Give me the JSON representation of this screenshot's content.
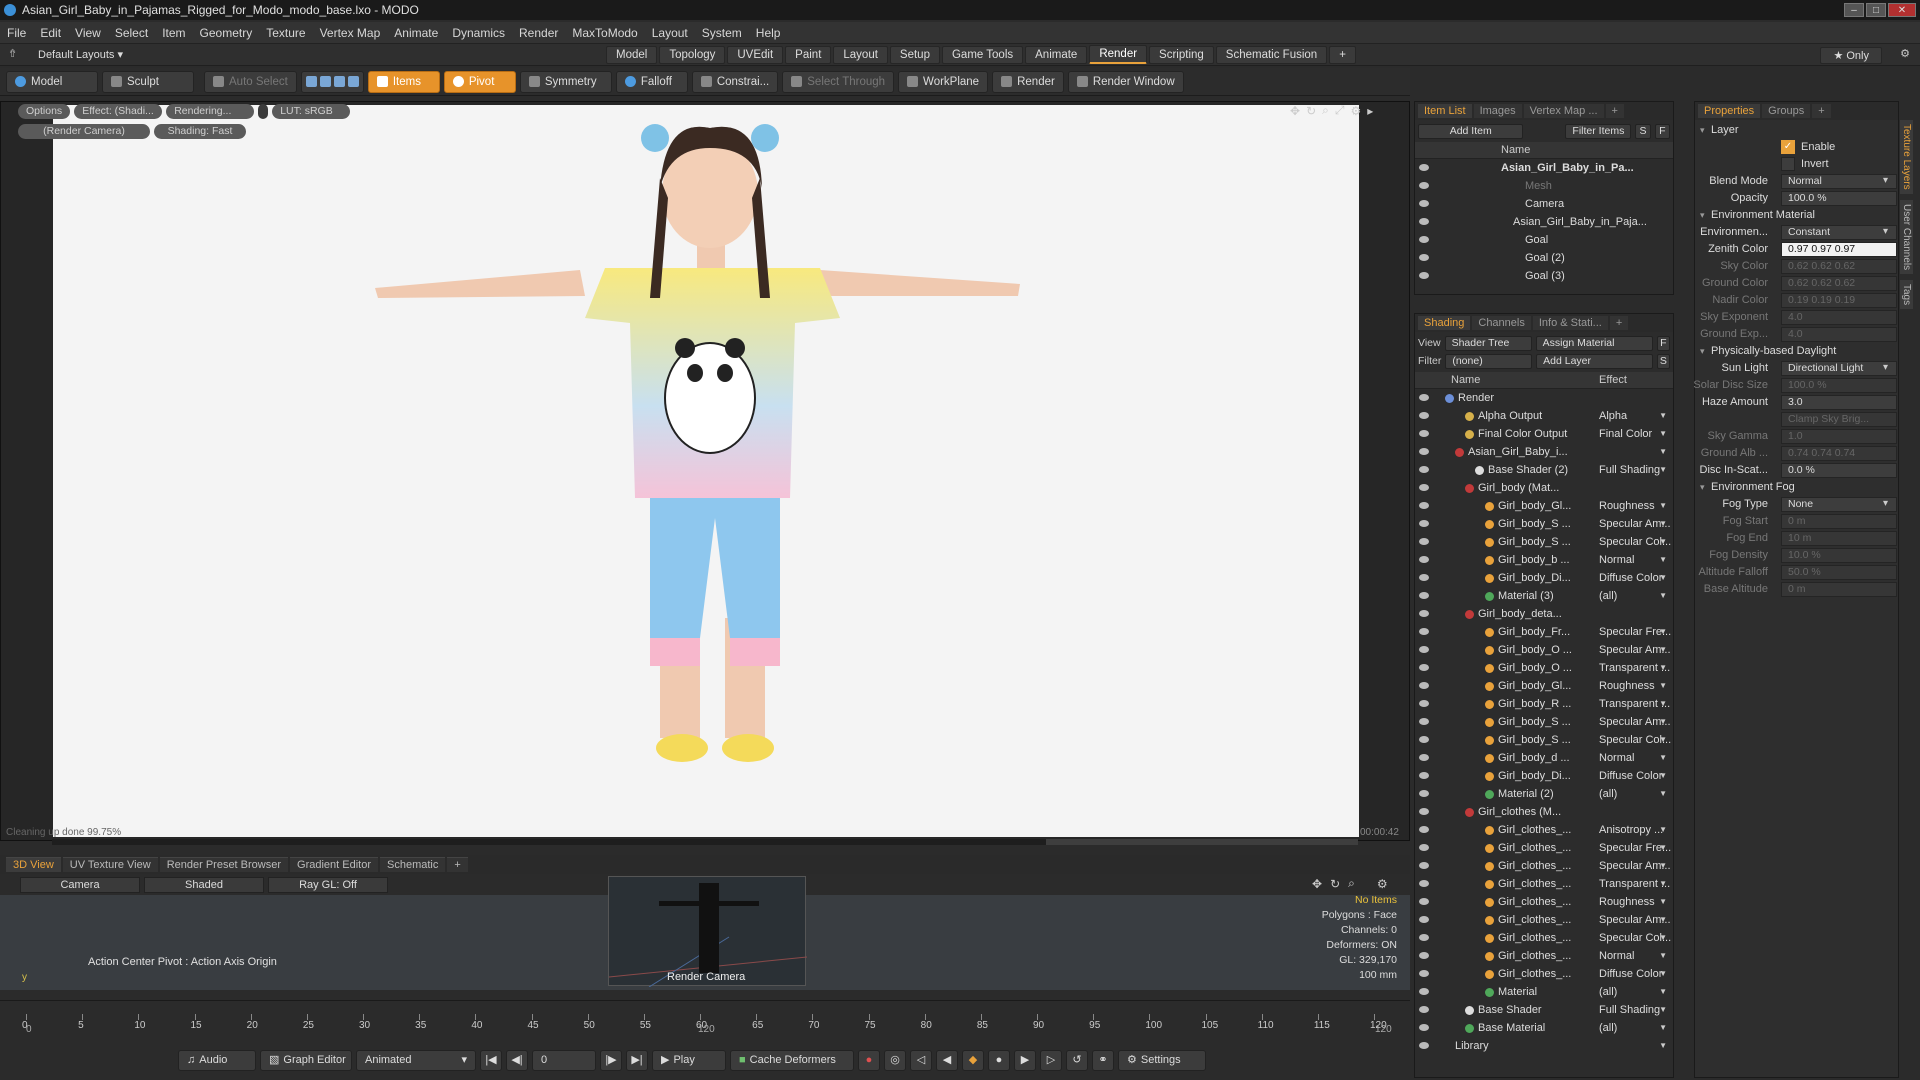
{
  "window": {
    "title": "Asian_Girl_Baby_in_Pajamas_Rigged_for_Modo_modo_base.lxo - MODO"
  },
  "menu": [
    "File",
    "Edit",
    "View",
    "Select",
    "Item",
    "Geometry",
    "Texture",
    "Vertex Map",
    "Animate",
    "Dynamics",
    "Render",
    "MaxToModo",
    "Layout",
    "System",
    "Help"
  ],
  "layout": {
    "name": "Default Layouts ▾",
    "only": "★  Only",
    "tabs": [
      {
        "label": "Model"
      },
      {
        "label": "Topology"
      },
      {
        "label": "UVEdit"
      },
      {
        "label": "Paint"
      },
      {
        "label": "Layout"
      },
      {
        "label": "Setup"
      },
      {
        "label": "Game Tools"
      },
      {
        "label": "Animate"
      },
      {
        "label": "Render",
        "active": true
      },
      {
        "label": "Scripting"
      },
      {
        "label": "Schematic Fusion"
      },
      {
        "label": "+"
      }
    ]
  },
  "toolbar": {
    "model": "Model",
    "sculpt": "Sculpt",
    "auto_select": "Auto Select",
    "items": "Items",
    "pivot": "Pivot",
    "symmetry": "Symmetry",
    "falloff": "Falloff",
    "constrain": "Constrai...",
    "select_through": "Select Through",
    "workplane": "WorkPlane",
    "render": "Render",
    "render_window": "Render Window"
  },
  "viewport": {
    "options": "Options",
    "effect": "Effect: (Shadi...",
    "rendering": "Rendering...",
    "lut": "LUT: sRGB",
    "camera": "(Render Camera)",
    "shading": "Shading: Fast",
    "status": "Cleaning up done 99.75%",
    "timer": "00:00:42"
  },
  "bottom": {
    "tabs": [
      "3D View",
      "UV Texture View",
      "Render Preset Browser",
      "Gradient Editor",
      "Schematic",
      "+"
    ],
    "camera": "Camera",
    "shaded": "Shaded",
    "raygl": "Ray GL: Off",
    "action_center": "Action Center Pivot : Action Axis Origin",
    "mini_label": "Render Camera",
    "stats": {
      "no_items": "No Items",
      "polygons": "Polygons : Face",
      "channels": "Channels: 0",
      "deformers": "Deformers: ON",
      "gl": "GL: 329,170",
      "size": "100 mm"
    }
  },
  "timeline": {
    "ticks": [
      "0",
      "5",
      "10",
      "15",
      "20",
      "25",
      "30",
      "35",
      "40",
      "45",
      "50",
      "55",
      "60",
      "65",
      "70",
      "75",
      "80",
      "85",
      "90",
      "95",
      "100",
      "105",
      "110",
      "115",
      "120"
    ],
    "start": "0",
    "end": "120",
    "mid": "120"
  },
  "transport": {
    "audio": "Audio",
    "graph_editor": "Graph Editor",
    "animated": "Animated",
    "frame": "0",
    "play": "Play",
    "cache_deformers": "Cache Deformers",
    "settings": "Settings"
  },
  "itemlist": {
    "tabs": [
      "Item List",
      "Images",
      "Vertex Map ...",
      "+"
    ],
    "add_item": "Add Item",
    "filter_items": "Filter Items",
    "s": "S",
    "f": "F",
    "name_header": "Name",
    "items": [
      {
        "name": "Asian_Girl_Baby_in_Pa...",
        "indent": 0,
        "bold": true
      },
      {
        "name": "Mesh",
        "indent": 2,
        "dim": true
      },
      {
        "name": "Camera",
        "indent": 2
      },
      {
        "name": "Asian_Girl_Baby_in_Paja...",
        "indent": 1
      },
      {
        "name": "Goal",
        "indent": 2
      },
      {
        "name": "Goal (2)",
        "indent": 2
      },
      {
        "name": "Goal (3)",
        "indent": 2
      }
    ]
  },
  "shading": {
    "tabs": [
      "Shading",
      "Channels",
      "Info & Stati...",
      "+"
    ],
    "view_label": "View",
    "view_value": "Shader Tree",
    "assign": "Assign Material",
    "f": "F",
    "filter_label": "Filter",
    "filter_value": "(none)",
    "add_layer": "Add Layer",
    "s": "S",
    "name_header": "Name",
    "effect_header": "Effect",
    "rows": [
      {
        "name": "Render",
        "effect": "",
        "indent": 0,
        "color": "#6c8fd8"
      },
      {
        "name": "Alpha Output",
        "effect": "Alpha",
        "indent": 2,
        "color": "#d6b04a"
      },
      {
        "name": "Final Color Output",
        "effect": "Final Color",
        "indent": 2,
        "color": "#d6b04a"
      },
      {
        "name": "Asian_Girl_Baby_i...",
        "effect": "",
        "indent": 1,
        "color": "#c23a3a"
      },
      {
        "name": "Base Shader (2)",
        "effect": "Full Shading",
        "indent": 3,
        "color": "#dddddd"
      },
      {
        "name": "Girl_body (Mat...",
        "effect": "",
        "indent": 2,
        "color": "#c23a3a"
      },
      {
        "name": "Girl_body_Gl...",
        "effect": "Roughness",
        "indent": 4,
        "color": "#e9a23b"
      },
      {
        "name": "Girl_body_S ...",
        "effect": "Specular Am...",
        "indent": 4,
        "color": "#e9a23b"
      },
      {
        "name": "Girl_body_S ...",
        "effect": "Specular Col...",
        "indent": 4,
        "color": "#e9a23b"
      },
      {
        "name": "Girl_body_b ...",
        "effect": "Normal",
        "indent": 4,
        "color": "#e9a23b"
      },
      {
        "name": "Girl_body_Di...",
        "effect": "Diffuse Color",
        "indent": 4,
        "color": "#e9a23b"
      },
      {
        "name": "Material (3)",
        "effect": "(all)",
        "indent": 4,
        "color": "#4fa85a"
      },
      {
        "name": "Girl_body_deta...",
        "effect": "",
        "indent": 2,
        "color": "#c23a3a"
      },
      {
        "name": "Girl_body_Fr...",
        "effect": "Specular Fre...",
        "indent": 4,
        "color": "#e9a23b"
      },
      {
        "name": "Girl_body_O ...",
        "effect": "Specular Am...",
        "indent": 4,
        "color": "#e9a23b"
      },
      {
        "name": "Girl_body_O ...",
        "effect": "Transparent ...",
        "indent": 4,
        "color": "#e9a23b"
      },
      {
        "name": "Girl_body_Gl...",
        "effect": "Roughness",
        "indent": 4,
        "color": "#e9a23b"
      },
      {
        "name": "Girl_body_R ...",
        "effect": "Transparent ...",
        "indent": 4,
        "color": "#e9a23b"
      },
      {
        "name": "Girl_body_S ...",
        "effect": "Specular Am...",
        "indent": 4,
        "color": "#e9a23b"
      },
      {
        "name": "Girl_body_S ...",
        "effect": "Specular Col...",
        "indent": 4,
        "color": "#e9a23b"
      },
      {
        "name": "Girl_body_d ...",
        "effect": "Normal",
        "indent": 4,
        "color": "#e9a23b"
      },
      {
        "name": "Girl_body_Di...",
        "effect": "Diffuse Color",
        "indent": 4,
        "color": "#e9a23b"
      },
      {
        "name": "Material (2)",
        "effect": "(all)",
        "indent": 4,
        "color": "#4fa85a"
      },
      {
        "name": "Girl_clothes (M...",
        "effect": "",
        "indent": 2,
        "color": "#c23a3a"
      },
      {
        "name": "Girl_clothes_...",
        "effect": "Anisotropy ...",
        "indent": 4,
        "color": "#e9a23b"
      },
      {
        "name": "Girl_clothes_...",
        "effect": "Specular Fre...",
        "indent": 4,
        "color": "#e9a23b"
      },
      {
        "name": "Girl_clothes_...",
        "effect": "Specular Am...",
        "indent": 4,
        "color": "#e9a23b"
      },
      {
        "name": "Girl_clothes_...",
        "effect": "Transparent ...",
        "indent": 4,
        "color": "#e9a23b"
      },
      {
        "name": "Girl_clothes_...",
        "effect": "Roughness",
        "indent": 4,
        "color": "#e9a23b"
      },
      {
        "name": "Girl_clothes_...",
        "effect": "Specular Am...",
        "indent": 4,
        "color": "#e9a23b"
      },
      {
        "name": "Girl_clothes_...",
        "effect": "Specular Col...",
        "indent": 4,
        "color": "#e9a23b"
      },
      {
        "name": "Girl_clothes_...",
        "effect": "Normal",
        "indent": 4,
        "color": "#e9a23b"
      },
      {
        "name": "Girl_clothes_...",
        "effect": "Diffuse Color",
        "indent": 4,
        "color": "#e9a23b"
      },
      {
        "name": "Material",
        "effect": "(all)",
        "indent": 4,
        "color": "#4fa85a"
      },
      {
        "name": "Base Shader",
        "effect": "Full Shading",
        "indent": 2,
        "color": "#dddddd"
      },
      {
        "name": "Base Material",
        "effect": "(all)",
        "indent": 2,
        "color": "#4fa85a"
      },
      {
        "name": "Library",
        "effect": "",
        "indent": 1,
        "color": ""
      }
    ]
  },
  "properties": {
    "tabs": [
      "Properties",
      "Groups",
      "+"
    ],
    "side_tabs": [
      "Texture Layers",
      "User Channels",
      "Tags"
    ],
    "layer": "Layer",
    "enable": "Enable",
    "invert": "Invert",
    "fields": [
      {
        "label": "Blend Mode",
        "value": "Normal",
        "dd": true
      },
      {
        "label": "Opacity",
        "value": "100.0 %"
      }
    ],
    "env_section": "Environment Material",
    "env_fields": [
      {
        "label": "Environmen...",
        "value": "Constant",
        "dd": true
      },
      {
        "label": "Zenith Color",
        "value": "0.97  0.97  0.97",
        "white": true
      },
      {
        "label": "Sky Color",
        "value": "0.62  0.62  0.62",
        "dim": true
      },
      {
        "label": "Ground Color",
        "value": "0.62  0.62  0.62",
        "dim": true
      },
      {
        "label": "Nadir Color",
        "value": "0.19  0.19  0.19",
        "dim": true
      },
      {
        "label": "Sky Exponent",
        "value": "4.0",
        "dim": true
      },
      {
        "label": "Ground Exp...",
        "value": "4.0",
        "dim": true
      }
    ],
    "daylight_section": "Physically-based Daylight",
    "daylight_fields": [
      {
        "label": "Sun Light",
        "value": "Directional Light",
        "dd": true
      },
      {
        "label": "Solar Disc Size",
        "value": "100.0 %",
        "dim": true
      },
      {
        "label": "Haze Amount",
        "value": "3.0"
      },
      {
        "label": "",
        "value": "Clamp Sky Brig...",
        "dim": true
      },
      {
        "label": "Sky Gamma",
        "value": "1.0",
        "dim": true
      },
      {
        "label": "Ground Alb ...",
        "value": "0.74  0.74  0.74",
        "dim": true
      },
      {
        "label": "Disc In-Scat...",
        "value": "0.0 %"
      }
    ],
    "fog_section": "Environment Fog",
    "fog_fields": [
      {
        "label": "Fog Type",
        "value": "None",
        "dd": true
      },
      {
        "label": "Fog Start",
        "value": "0 m",
        "dim": true
      },
      {
        "label": "Fog End",
        "value": "10 m",
        "dim": true
      },
      {
        "label": "Fog Density",
        "value": "10.0 %",
        "dim": true
      },
      {
        "label": "Altitude Falloff",
        "value": "50.0 %",
        "dim": true
      },
      {
        "label": "Base Altitude",
        "value": "0 m",
        "dim": true
      }
    ]
  }
}
